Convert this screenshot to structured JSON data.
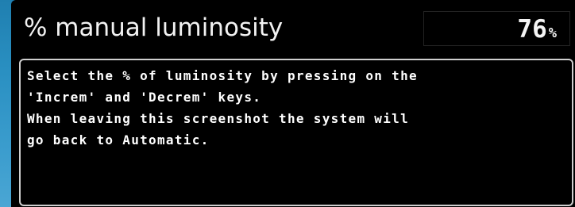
{
  "header": {
    "title": "% manual luminosity",
    "value": "76",
    "unit": "%"
  },
  "message": {
    "lines": [
      "Select the % of luminosity by pressing on the",
      "'Increm' and 'Decrem' keys.",
      "When leaving this screenshot the system will",
      "go back to Automatic."
    ]
  },
  "colors": {
    "background_blue": "#2a90c2",
    "panel": "#000000",
    "text": "#ffffff",
    "border": "#cfcfcf"
  }
}
